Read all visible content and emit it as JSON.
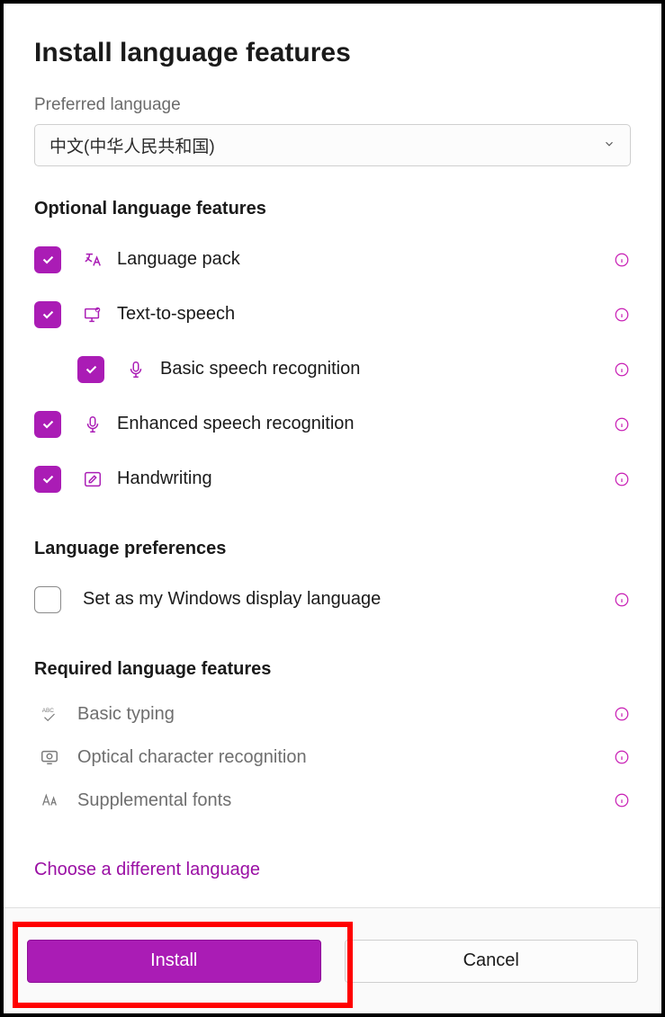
{
  "title": "Install language features",
  "preferred": {
    "label": "Preferred language",
    "value": "中文(中华人民共和国)"
  },
  "sections": {
    "optional": "Optional language features",
    "preferences": "Language preferences",
    "required": "Required language features"
  },
  "features": {
    "language_pack": "Language pack",
    "tts": "Text-to-speech",
    "basic_speech": "Basic speech recognition",
    "enhanced_speech": "Enhanced speech recognition",
    "handwriting": "Handwriting",
    "set_display": "Set as my Windows display language",
    "basic_typing": "Basic typing",
    "ocr": "Optical character recognition",
    "supp_fonts": "Supplemental fonts"
  },
  "link": "Choose a different language",
  "buttons": {
    "install": "Install",
    "cancel": "Cancel"
  }
}
